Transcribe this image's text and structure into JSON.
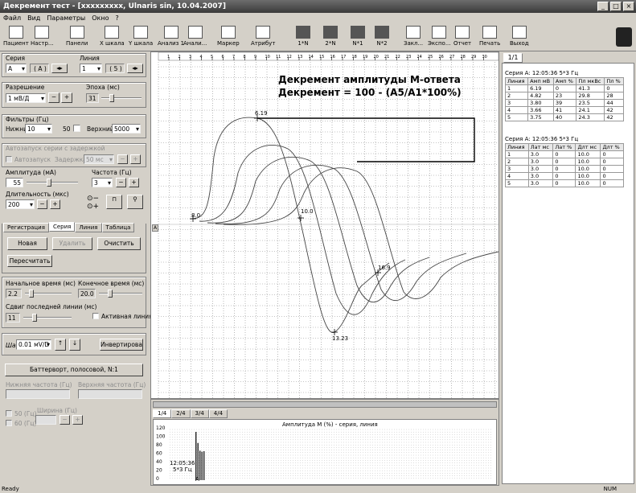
{
  "window": {
    "title": "Декремент тест - [xxxxxxxxx, Ulnaris sin, 10.04.2007]",
    "min": "_",
    "max": "□",
    "close": "×"
  },
  "menu": [
    "Файл",
    "Вид",
    "Параметры",
    "Окно",
    "?"
  ],
  "toolbar": {
    "items": [
      "Пациент",
      "Настр...",
      "Панели",
      "X шкала",
      "Y шкала",
      "Анализ 1",
      "Анали...",
      "Маркер",
      "Атрибут",
      "1*N",
      "2*N",
      "N*1",
      "N*2",
      "Закл...",
      "Экспо...",
      "Отчет",
      "Печать",
      "Выход"
    ]
  },
  "left": {
    "series_label": "Серия",
    "series_value": "A",
    "series_ind": "( A )",
    "line_label": "Линия",
    "line_value": "1",
    "line_ind": "( 5 )",
    "resolution_label": "Разрешение",
    "resolution_value": "1 мВ/Д",
    "minus": "−",
    "plus": "+",
    "epoch_label": "Эпоха (мс)",
    "epoch_value": "31",
    "filters_label": "Фильтры (Гц)",
    "low_label": "Нижний",
    "low_value": "10",
    "notch_value": "50",
    "high_label": "Верхний",
    "high_value": "5000",
    "autostart_label": "Автозапуск серии с задержкой",
    "autostart_chk": "Автозапуск",
    "delay_label": "Задержка",
    "delay_value": "50 мс",
    "amp_label": "Амплитуда (мА)",
    "amp_value": "55",
    "freq_label": "Частота (Гц)",
    "freq_value": "3",
    "dur_label": "Длительность (мкс)",
    "dur_value": "200",
    "tabs": [
      "Регистрация",
      "Серия",
      "Линия",
      "Таблица"
    ],
    "new_btn": "Новая",
    "delete_btn": "Удалить",
    "clear_btn": "Очистить",
    "recalc_btn": "Пересчитать",
    "start_label": "Начальное время (мс)",
    "start_value": "2.2",
    "end_label": "Конечное время (мс)",
    "end_value": "20.0",
    "shift_label": "Сдвиг последней линии (мс)",
    "shift_value": "11",
    "active_label": "Активная линия",
    "step_label": "Шаг:",
    "step_value": "0.01 мV/D",
    "invert_btn": "Инвертировать",
    "butter_btn": "Баттерворт, полосовой, N:1",
    "lowfreq_label": "Нижняя частота (Гц)",
    "highfreq_label": "Верхняя частота (Гц)",
    "f50": "50 (Гц)",
    "f60": "60 (Гц)",
    "width_label": "Ширина (Гц)"
  },
  "ruler": [
    "1",
    "2",
    "3",
    "4",
    "5",
    "6",
    "7",
    "8",
    "9",
    "10",
    "11",
    "12",
    "13",
    "14",
    "15",
    "16",
    "17",
    "18",
    "19",
    "20",
    "21",
    "22",
    "23",
    "24",
    "25",
    "26",
    "27",
    "28",
    "29",
    "30"
  ],
  "plot": {
    "title1": "Декремент амплитуды М-ответа",
    "title2": "Декремент = 100 - (A5/A1*100%)",
    "m1": "6.19",
    "m2": "8.0",
    "m3": "10.0",
    "m4": "16.9",
    "m5": "13.23",
    "side": "A"
  },
  "bottom": {
    "tabs": [
      "1/4",
      "2/4",
      "3/4",
      "4/4"
    ],
    "chart_title": "Амплитуда М (%) - серия, линия",
    "time": "12:05:36",
    "freq": "5*3 Гц",
    "series": "A",
    "yticks": [
      "120",
      "100",
      "80",
      "60",
      "40",
      "20",
      "0"
    ]
  },
  "right": {
    "tab": "1/1",
    "t1_title": "Серия A: 12:05:36 5*3 Гц",
    "t1_headers": [
      "Линия",
      "Амп мВ",
      "Амп %",
      "Пл мкВс",
      "Пл %"
    ],
    "t1_rows": [
      [
        "1",
        "6.19",
        "0",
        "41.3",
        "0"
      ],
      [
        "2",
        "4.82",
        "23",
        "29.8",
        "28"
      ],
      [
        "3",
        "3.80",
        "39",
        "23.5",
        "44"
      ],
      [
        "4",
        "3.66",
        "41",
        "24.1",
        "42"
      ],
      [
        "5",
        "3.75",
        "40",
        "24.3",
        "42"
      ]
    ],
    "t2_title": "Серия A: 12:05:36 5*3 Гц",
    "t2_headers": [
      "Линия",
      "Лат мс",
      "Лат %",
      "Длт мс",
      "Длт %"
    ],
    "t2_rows": [
      [
        "1",
        "3.0",
        "0",
        "10.0",
        "0"
      ],
      [
        "2",
        "3.0",
        "0",
        "10.0",
        "0"
      ],
      [
        "3",
        "3.0",
        "0",
        "10.0",
        "0"
      ],
      [
        "4",
        "3.0",
        "0",
        "10.0",
        "0"
      ],
      [
        "5",
        "3.0",
        "0",
        "10.0",
        "0"
      ]
    ]
  },
  "status": {
    "left": "Ready",
    "right": "NUM"
  }
}
